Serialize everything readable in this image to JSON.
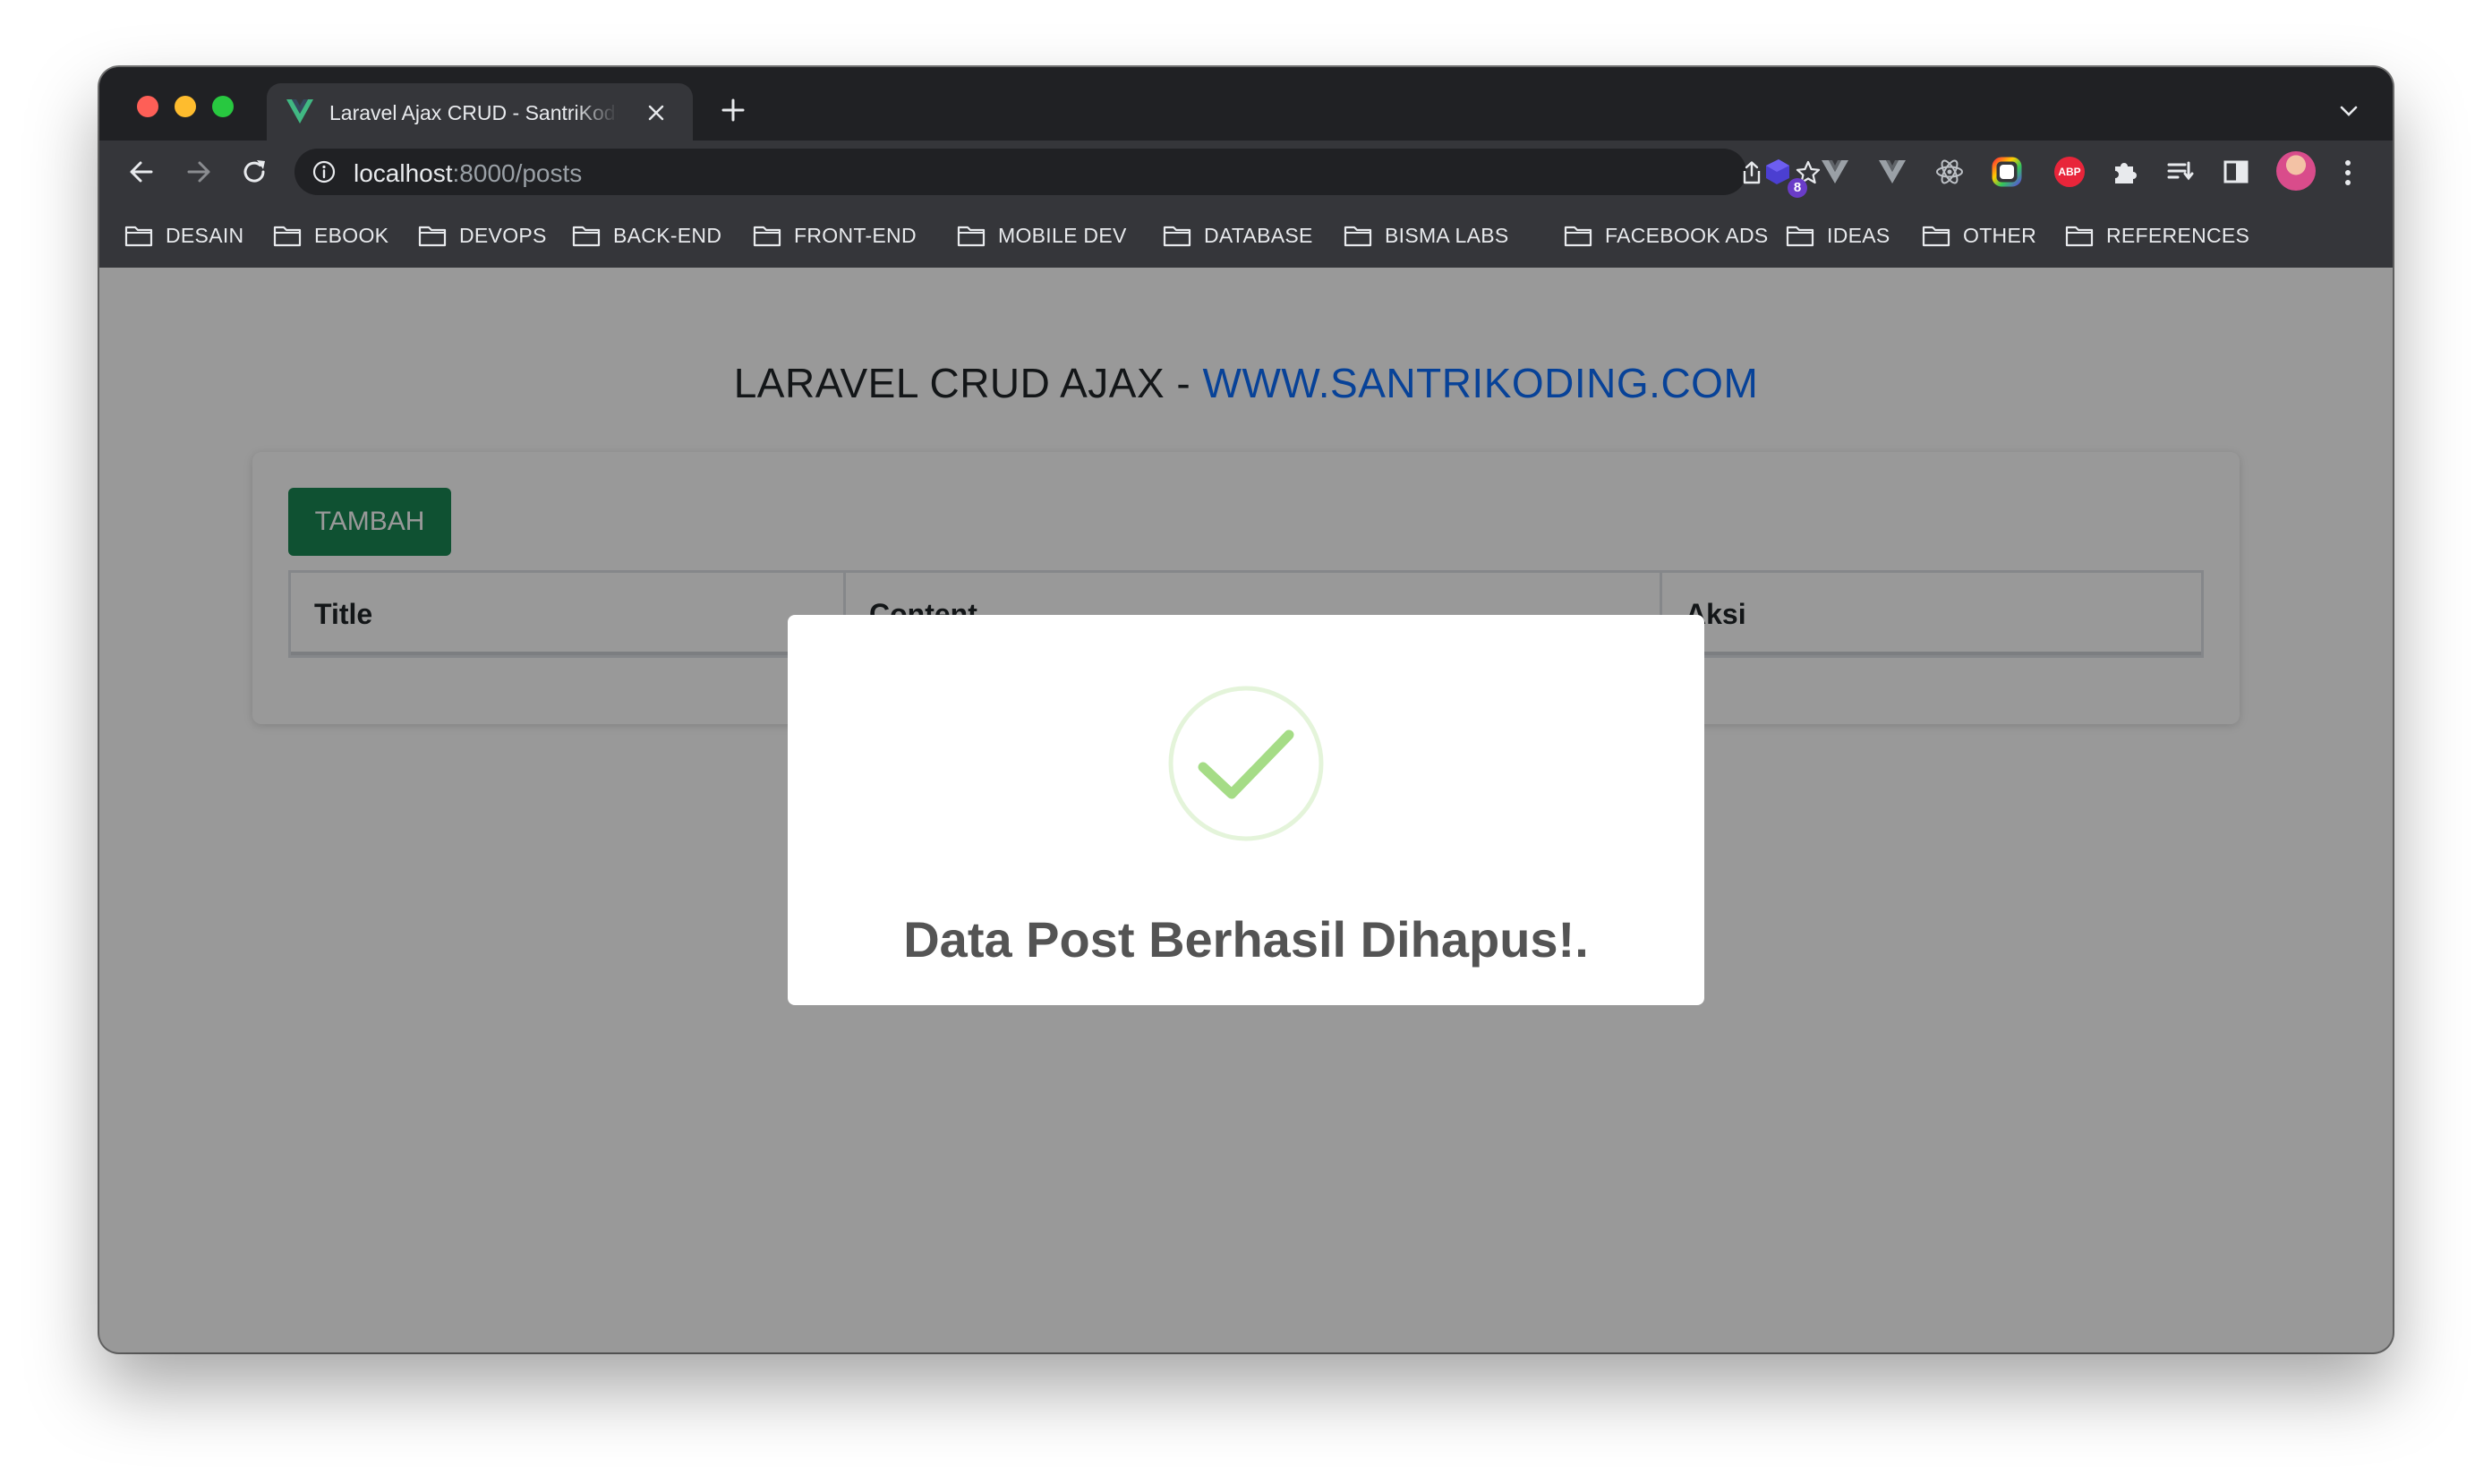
{
  "browser": {
    "tab": {
      "title": "Laravel Ajax CRUD - SantriKoding.com",
      "favicon": "vue-logo-icon"
    },
    "address_bar": {
      "host": "localhost",
      "rest": ":8000/posts"
    },
    "extensions": {
      "badge_count": "8",
      "abp_label": "ABP",
      "icons": [
        "vue-devtools-icon",
        "vue-devtools-icon",
        "react-devtools-icon",
        "color-picker-icon",
        "adblock-icon",
        "extensions-puzzle-icon",
        "reading-list-icon",
        "side-panel-icon"
      ]
    },
    "bookmarks": [
      "DESAIN",
      "EBOOK",
      "DEVOPS",
      "BACK-END",
      "FRONT-END",
      "MOBILE DEV",
      "DATABASE",
      "BISMA LABS",
      "FACEBOOK ADS",
      "IDEAS",
      "OTHER",
      "REFERENCES"
    ]
  },
  "page": {
    "heading_text": "LARAVEL CRUD AJAX - ",
    "heading_link": "WWW.SANTRIKODING.COM",
    "add_button": "TAMBAH",
    "table": {
      "columns": [
        "Title",
        "Content",
        "Aksi"
      ]
    }
  },
  "modal": {
    "icon": "success-check-icon",
    "title": "Data Post Berhasil Dihapus!."
  },
  "colors": {
    "success_button": "#198754",
    "link": "#0d6efd",
    "check": "#a5dc86",
    "check_ring": "rgba(165,220,134,0.3)"
  }
}
